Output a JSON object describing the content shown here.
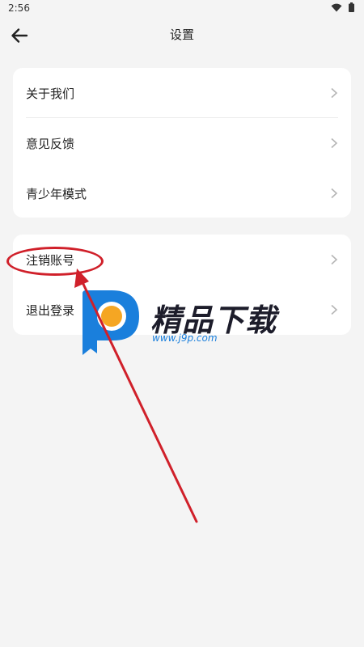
{
  "status_bar": {
    "time": "2:56"
  },
  "header": {
    "title": "设置"
  },
  "group1": {
    "items": [
      {
        "label": "关于我们"
      },
      {
        "label": "意见反馈"
      },
      {
        "label": "青少年模式"
      }
    ]
  },
  "group2": {
    "items": [
      {
        "label": "注销账号"
      },
      {
        "label": "退出登录"
      }
    ]
  },
  "watermark": {
    "text": "精品下载",
    "url": "www.j9p.com"
  },
  "colors": {
    "annotation_red": "#d0202a",
    "background": "#f4f4f4",
    "card": "#ffffff",
    "watermark_blue": "#1a7fdc",
    "watermark_orange": "#f5a623"
  }
}
